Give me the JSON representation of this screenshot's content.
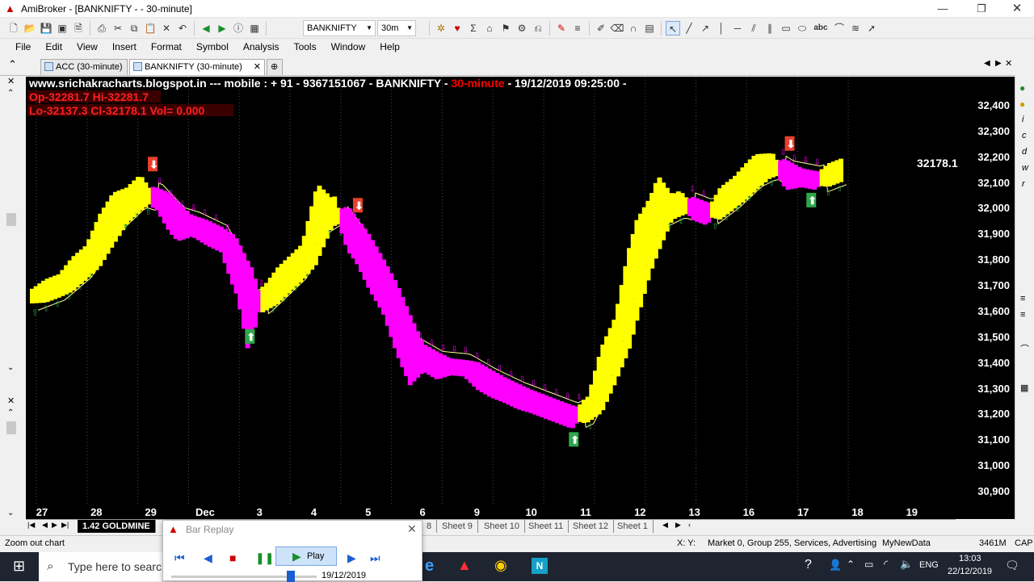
{
  "window": {
    "title": "AmiBroker - [BANKNIFTY -  - 30-minute]",
    "app_icon": "amibroker-logo-icon"
  },
  "toolbar": {
    "symbol": "BANKNIFTY",
    "interval": "30m"
  },
  "menu": [
    "File",
    "Edit",
    "View",
    "Insert",
    "Format",
    "Symbol",
    "Analysis",
    "Tools",
    "Window",
    "Help"
  ],
  "tabs": [
    {
      "label": "ACC (30-minute)"
    },
    {
      "label": "BANKNIFTY (30-minute)"
    }
  ],
  "chart": {
    "header_site": "www.srichakracharts.blogspot.in ---  mobile :  + 91 - 9367151067 - BANKNIFTY - ",
    "header_interval": "30-minute",
    "header_date": " - 19/12/2019 09:25:00 -",
    "ohlc_line1": "Op-32281.7  Hi-32281.7",
    "ohlc_line2": "Lo-32137.3  Cl-32178.1  Vol=   0.000",
    "last_price_label": "32178.1",
    "colors": {
      "up": "#ffff00",
      "down": "#ff00ff",
      "stop_line": "#ffff99",
      "buy_signal": "#2ea84a",
      "sell_signal": "#e8412c"
    }
  },
  "chart_data": {
    "type": "candlestick-trend",
    "symbol": "BANKNIFTY",
    "interval": "30-minute",
    "ylim": [
      30850,
      32450
    ],
    "y_ticks": [
      "32,400",
      "32,300",
      "32,200",
      "32,100",
      "32,000",
      "31,900",
      "31,800",
      "31,700",
      "31,600",
      "31,500",
      "31,400",
      "31,300",
      "31,200",
      "31,100",
      "31,000",
      "30,900"
    ],
    "x_ticks": [
      "27",
      "28",
      "29",
      "Dec",
      "3",
      "4",
      "5",
      "6",
      "9",
      "10",
      "11",
      "12",
      "13",
      "16",
      "17",
      "18",
      "19"
    ],
    "price_path": [
      {
        "x": 0.0,
        "v": 31660
      },
      {
        "x": 0.5,
        "v": 31700
      },
      {
        "x": 1.0,
        "v": 31790
      },
      {
        "x": 1.5,
        "v": 31960
      },
      {
        "x": 2.0,
        "v": 32060
      },
      {
        "x": 2.3,
        "v": 32040
      },
      {
        "x": 2.7,
        "v": 31950
      },
      {
        "x": 3.0,
        "v": 31930
      },
      {
        "x": 3.5,
        "v": 31880
      },
      {
        "x": 3.8,
        "v": 31770
      },
      {
        "x": 4.0,
        "v": 31620
      },
      {
        "x": 4.3,
        "v": 31650
      },
      {
        "x": 4.6,
        "v": 31710
      },
      {
        "x": 5.0,
        "v": 31790
      },
      {
        "x": 5.3,
        "v": 31950
      },
      {
        "x": 5.6,
        "v": 31990
      },
      {
        "x": 6.0,
        "v": 31880
      },
      {
        "x": 6.5,
        "v": 31700
      },
      {
        "x": 7.0,
        "v": 31450
      },
      {
        "x": 7.5,
        "v": 31390
      },
      {
        "x": 8.0,
        "v": 31380
      },
      {
        "x": 8.5,
        "v": 31320
      },
      {
        "x": 9.0,
        "v": 31270
      },
      {
        "x": 9.5,
        "v": 31230
      },
      {
        "x": 10.0,
        "v": 31190
      },
      {
        "x": 10.3,
        "v": 31220
      },
      {
        "x": 10.8,
        "v": 31450
      },
      {
        "x": 11.2,
        "v": 31760
      },
      {
        "x": 11.6,
        "v": 31980
      },
      {
        "x": 12.0,
        "v": 32020
      },
      {
        "x": 12.5,
        "v": 31980
      },
      {
        "x": 13.0,
        "v": 32060
      },
      {
        "x": 13.4,
        "v": 32140
      },
      {
        "x": 13.7,
        "v": 32170
      },
      {
        "x": 14.0,
        "v": 32130
      },
      {
        "x": 14.5,
        "v": 32110
      },
      {
        "x": 15.0,
        "v": 32150
      }
    ],
    "buy_signals": [
      {
        "x": 4.0,
        "v": 31500
      },
      {
        "x": 10.0,
        "v": 31100
      },
      {
        "x": 14.4,
        "v": 32030
      }
    ],
    "sell_signals": [
      {
        "x": 2.2,
        "v": 32170
      },
      {
        "x": 6.0,
        "v": 32010
      },
      {
        "x": 14.0,
        "v": 32250
      }
    ],
    "last_price": 32178.1
  },
  "sheets": {
    "active": "1.42 GOLDMINE",
    "others": [
      "8",
      "Sheet 9",
      "Sheet 10",
      "Sheet 11",
      "Sheet 12",
      "Sheet 1"
    ]
  },
  "status": {
    "left": "Zoom out chart",
    "coords": "X:   Y:",
    "info": "Market 0, Group 255, Services, Advertising",
    "db": "MyNewData",
    "mem": "3461M",
    "cap": "CAP"
  },
  "replay": {
    "title": "Bar Replay",
    "play_label": "Play",
    "date": "19/12/2019",
    "progress": 0.82
  },
  "taskbar": {
    "search_placeholder": "Type here to search",
    "time": "13:03",
    "date": "22/12/2019",
    "lang": "ENG"
  }
}
